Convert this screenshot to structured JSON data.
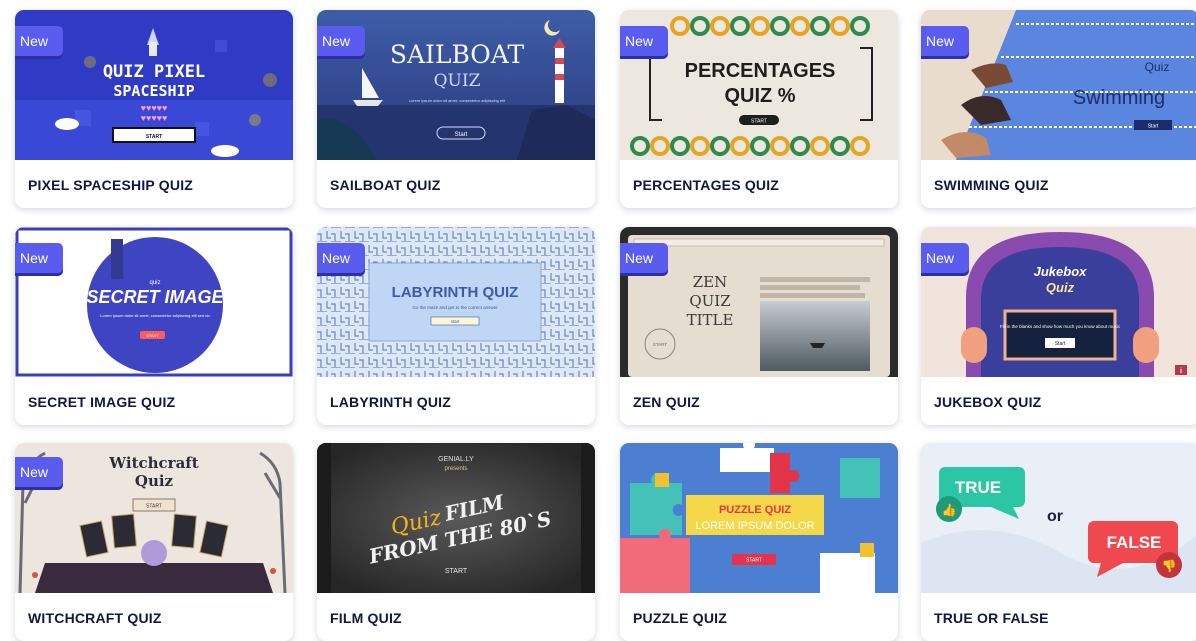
{
  "badge_text": "New",
  "cards": [
    {
      "title": "PIXEL SPACESHIP QUIZ",
      "new": true,
      "thumb": {
        "line1": "QUIZ PIXEL",
        "line2": "SPACESHIP",
        "button": "START"
      }
    },
    {
      "title": "SAILBOAT QUIZ",
      "new": true,
      "thumb": {
        "line1": "SAILBOAT",
        "line2": "QUIZ",
        "sub": "Lorem ipsum dolor sit amet, consectetur adipiscing elit",
        "button": "Start"
      }
    },
    {
      "title": "PERCENTAGES QUIZ",
      "new": true,
      "thumb": {
        "line1": "PERCENTAGES",
        "line2": "QUIZ %",
        "button": "START"
      }
    },
    {
      "title": "SWIMMING QUIZ",
      "new": true,
      "thumb": {
        "line1": "Quiz",
        "line2": "Swimming",
        "button": "Start"
      }
    },
    {
      "title": "SECRET IMAGE QUIZ",
      "new": true,
      "thumb": {
        "line0": "quiz",
        "line1": "SECRET IMAGE",
        "sub": "Lorem ipsum dolor sit amet, consectetur adipiscing elit sed do",
        "button": "START"
      }
    },
    {
      "title": "LABYRINTH QUIZ",
      "new": true,
      "thumb": {
        "line1": "LABYRINTH QUIZ",
        "sub": "Go the maze and get to the correct answer",
        "button": "start"
      }
    },
    {
      "title": "ZEN QUIZ",
      "new": true,
      "thumb": {
        "line1": "ZEN",
        "line2": "QUIZ",
        "line3": "TITLE",
        "button": "START"
      }
    },
    {
      "title": "JUKEBOX QUIZ",
      "new": true,
      "thumb": {
        "line1": "Jukebox",
        "line2": "Quiz",
        "sub": "Fill in the blanks and show how much you know about music",
        "button": "Start",
        "info": "i"
      }
    },
    {
      "title": "WITCHCRAFT QUIZ",
      "new": true,
      "thumb": {
        "line1": "Witchcraft",
        "line2": "Quiz",
        "button": "START"
      }
    },
    {
      "title": "FILM QUIZ",
      "new": false,
      "thumb": {
        "top1": "GENIAL.LY",
        "top2": "presents",
        "line1": "Quiz",
        "line1b": "FILM",
        "line2": "FROM THE 80`S",
        "button": "START"
      }
    },
    {
      "title": "PUZZLE QUIZ",
      "new": false,
      "thumb": {
        "line1": "PUZZLE QUIZ",
        "line2": "LOREM IPSUM DOLOR",
        "button": "START"
      }
    },
    {
      "title": "TRUE OR FALSE",
      "new": false,
      "thumb": {
        "true": "TRUE",
        "or": "or",
        "false": "FALSE"
      }
    }
  ]
}
